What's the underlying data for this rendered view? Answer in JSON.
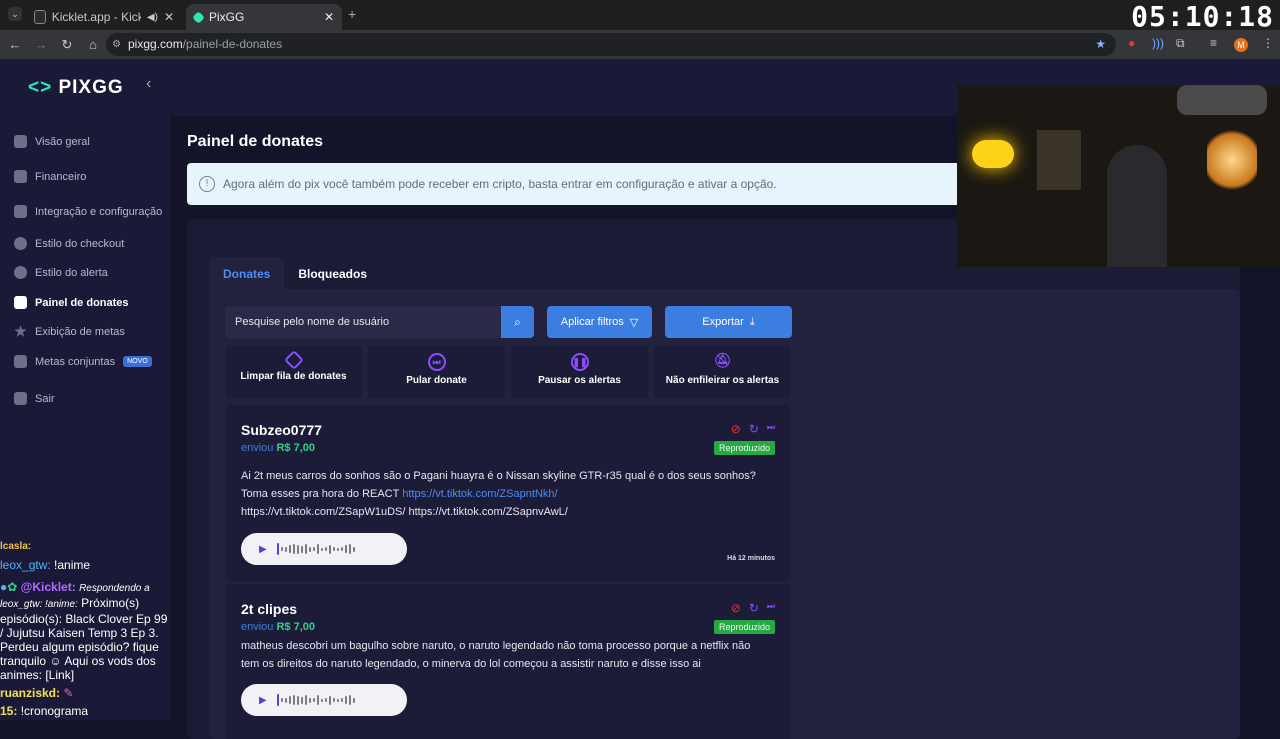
{
  "browser": {
    "tabs": [
      {
        "title": "Kicklet.app - Kick Chatbot a"
      },
      {
        "title": "PixGG"
      }
    ],
    "new_tab": "+",
    "url_domain": "pixgg.com",
    "url_path": "/painel-de-donates",
    "clock": "05:10:18"
  },
  "sidebar": {
    "logo": "PIXGG",
    "items": [
      {
        "label": "Visão geral"
      },
      {
        "label": "Financeiro"
      },
      {
        "label": "Integração e configuração"
      },
      {
        "label": "Estilo do checkout"
      },
      {
        "label": "Estilo do alerta"
      },
      {
        "label": "Painel de donates"
      },
      {
        "label": "Exibição de metas"
      },
      {
        "label": "Metas conjuntas",
        "badge": "NOVO"
      },
      {
        "label": "Sair"
      }
    ]
  },
  "chat": {
    "l1": "lcasla:",
    "l2_user": "leox_gtw:",
    "l2_msg": "!anime",
    "l3_user": "@Kicklet:",
    "l3_reply": "Respondendo a leox_gtw: !anime:",
    "l3_msg": "Próximo(s) episódio(s): Black Clover Ep 99 / Jujutsu Kaisen Temp 3 Ep 3. Perdeu algum episódio? fique tranquilo",
    "l3_msg2": "Aqui os vods dos animes: [Link]",
    "l4_user": "ruanziskd:",
    "l5_user": "15:",
    "l5_msg": "!cronograma"
  },
  "main": {
    "title": "Painel de donates",
    "alert": "Agora além do pix você também pode receber em cripto, basta entrar em configuração e ativar a opção.",
    "tabs": [
      {
        "label": "Donates"
      },
      {
        "label": "Bloqueados"
      }
    ],
    "search_placeholder": "Pesquise pelo nome de usuário",
    "filter_btn": "Aplicar filtros",
    "export_btn": "Exportar",
    "actions": [
      {
        "label": "Limpar fila de donates"
      },
      {
        "label": "Pular donate"
      },
      {
        "label": "Pausar os alertas"
      },
      {
        "label": "Não enfileirar os alertas"
      }
    ],
    "donates": [
      {
        "name": "Subzeo0777",
        "sent": "enviou",
        "amount": "R$ 7,00",
        "status": "Reproduzido",
        "msg1": "Ai 2t meus carros do sonhos são o Pagani huayra é o Nissan skyline GTR-r35 qual é o dos seus sonhos?Toma esses pra hora do REACT",
        "link1": "https://vt.tiktok.com/ZSapntNkh/",
        "msg2": "https://vt.tiktok.com/ZSapW1uDS/ https://vt.tiktok.com/ZSapnvAwL/",
        "time": "Há 12 minutos"
      },
      {
        "name": "2t clipes",
        "sent": "enviou",
        "amount": "R$ 7,00",
        "status": "Reproduzido",
        "msg1": "matheus descobri um bagulho sobre naruto, o naruto legendado não toma processo porque a netflix não tem os direitos do naruto legendado, o minerva do lol começou a assistir naruto e disse isso ai"
      }
    ]
  }
}
